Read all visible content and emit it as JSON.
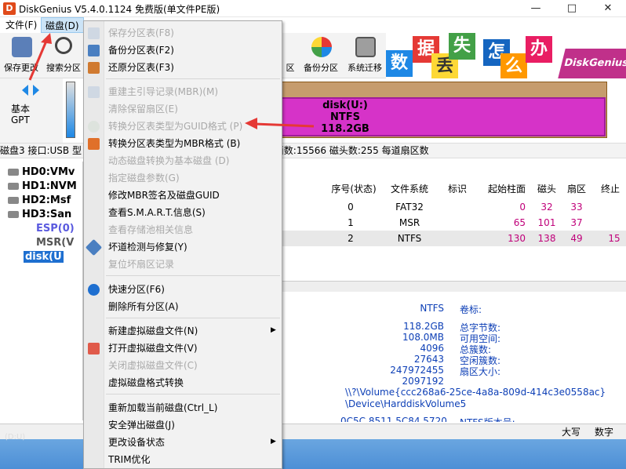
{
  "window": {
    "title": "DiskGenius V5.4.0.1124 免费版(单文件PE版)",
    "app_icon_letter": "D",
    "minimize": "—",
    "maximize": "□",
    "close": "✕"
  },
  "menubar": {
    "file": "文件(F)",
    "disk": "磁盘(D)"
  },
  "toolbar": {
    "save": "保存更改",
    "search": "搜索分区",
    "recover": "区",
    "backup": "备份分区",
    "migrate": "系统迁移"
  },
  "banner": {
    "tiles": [
      "数",
      "据",
      "丢",
      "失",
      "怎",
      "么",
      "办"
    ],
    "brand": "DiskGenius"
  },
  "disk_panel": {
    "type": "基本",
    "style": "GPT"
  },
  "partition_bar": {
    "name": "disk(U:)",
    "fs": "NTFS",
    "size": "118.2GB"
  },
  "disk_info_line": "磁盘3 接口:USB  型  020900284  容量:119.2GB(122104MB)  柱面数:15566  磁头数:255  每道扇区数",
  "tree": {
    "items": [
      "HD0:VMv",
      "HD1:NVM",
      "HD2:Msf",
      "HD3:San",
      "ESP(0)",
      "MSR(V",
      "disk(U"
    ]
  },
  "table": {
    "headers": [
      "序号(状态)",
      "文件系统",
      "标识",
      "起始柱面",
      "磁头",
      "扇区",
      "终止"
    ],
    "rows": [
      {
        "idx": "0",
        "fs": "FAT32",
        "cyl": "0",
        "head": "32",
        "sec": "33",
        "end": ""
      },
      {
        "idx": "1",
        "fs": "MSR",
        "cyl": "65",
        "head": "101",
        "sec": "37",
        "end": ""
      },
      {
        "idx": "2",
        "fs": "NTFS",
        "cyl": "130",
        "head": "138",
        "sec": "49",
        "end": "15"
      }
    ]
  },
  "details": {
    "fs_value": "NTFS",
    "fs_label": "卷标:",
    "values": [
      "118.2GB",
      "108.0MB",
      "4096",
      "27643",
      "247972455",
      "2097192"
    ],
    "labels": [
      "总字节数:",
      "可用空间:",
      "总簇数:",
      "空闲簇数:",
      "扇区大小:"
    ],
    "volume_path": "\\\\?\\Volume{ccc268a6-25ce-4a8a-809d-414c3e0558ac}",
    "device_path": "\\Device\\HarddiskVolume5",
    "partial_line": "0C5C 8511 5C84 5720",
    "partial_label": "NTFS版本号:"
  },
  "statusbar": {
    "caps": "大写",
    "num": "数字",
    "left_hint": "(D:U)"
  },
  "context_menu": {
    "items": [
      {
        "label": "保存分区表(F8)",
        "enabled": false
      },
      {
        "label": "备份分区表(F2)",
        "enabled": true
      },
      {
        "label": "还原分区表(F3)",
        "enabled": true
      },
      {
        "label": "重建主引导记录(MBR)(M)",
        "enabled": false
      },
      {
        "label": "清除保留扇区(E)",
        "enabled": false
      },
      {
        "label": "转换分区表类型为GUID格式 (P)",
        "enabled": false
      },
      {
        "label": "转换分区表类型为MBR格式 (B)",
        "enabled": true
      },
      {
        "label": "动态磁盘转换为基本磁盘 (D)",
        "enabled": false
      },
      {
        "label": "指定磁盘参数(G)",
        "enabled": false
      },
      {
        "label": "修改MBR签名及磁盘GUID",
        "enabled": true
      },
      {
        "label": "查看S.M.A.R.T.信息(S)",
        "enabled": true
      },
      {
        "label": "查看存储池相关信息",
        "enabled": false
      },
      {
        "label": "坏道检测与修复(Y)",
        "enabled": true
      },
      {
        "label": "复位坏扇区记录",
        "enabled": false
      },
      {
        "label": "快速分区(F6)",
        "enabled": true
      },
      {
        "label": "删除所有分区(A)",
        "enabled": true
      },
      {
        "label": "新建虚拟磁盘文件(N)",
        "enabled": true
      },
      {
        "label": "打开虚拟磁盘文件(V)",
        "enabled": true
      },
      {
        "label": "关闭虚拟磁盘文件(C)",
        "enabled": false
      },
      {
        "label": "虚拟磁盘格式转换",
        "enabled": true
      },
      {
        "label": "重新加载当前磁盘(Ctrl_L)",
        "enabled": true
      },
      {
        "label": "安全弹出磁盘(J)",
        "enabled": true
      },
      {
        "label": "更改设备状态",
        "enabled": true
      },
      {
        "label": "TRIM优化",
        "enabled": true
      }
    ],
    "submenu_arrow": "▶"
  },
  "colors": {
    "accent_arrow": "#e53935",
    "partition_fill": "#d633c8",
    "number_text": "#c0007a",
    "info_text": "#0d3fb6"
  }
}
